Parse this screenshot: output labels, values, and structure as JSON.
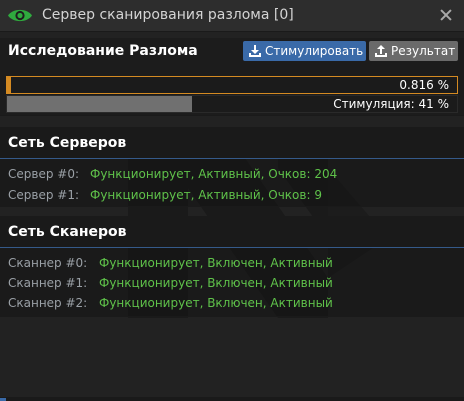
{
  "window": {
    "title": "Сервер сканирования разлома [0]"
  },
  "research": {
    "title": "Исследование Разлома",
    "stimulate_label": "Стимулировать",
    "result_label": "Результат",
    "progress_text": "0.816 %",
    "progress_value_percent": 0.816,
    "stimulation_text": "Стимуляция: 41 %",
    "stimulation_value_percent": 41
  },
  "servers": {
    "title": "Сеть Серверов",
    "items": [
      {
        "label": "Сервер #0:",
        "status": "Функционирует, Активный, Очков: 204"
      },
      {
        "label": "Сервер #1:",
        "status": "Функционирует, Активный, Очков: 9"
      }
    ]
  },
  "scanners": {
    "title": "Сеть Сканеров",
    "items": [
      {
        "label": "Сканнер #0:",
        "status": "Функционирует, Включен, Активный"
      },
      {
        "label": "Сканнер #1:",
        "status": "Функционирует, Включен, Активный"
      },
      {
        "label": "Сканнер #2:",
        "status": "Функционирует, Включен, Активный"
      }
    ]
  },
  "colors": {
    "accent_blue": "#3a6aa8",
    "progress_orange": "#d48a22",
    "status_green": "#5fc24a",
    "eye_green": "#2faa3e"
  },
  "icons": {
    "title": "eye-icon",
    "close": "close-icon",
    "stimulate": "download-icon",
    "result": "upload-icon",
    "watermark": "nt-logo-watermark"
  }
}
